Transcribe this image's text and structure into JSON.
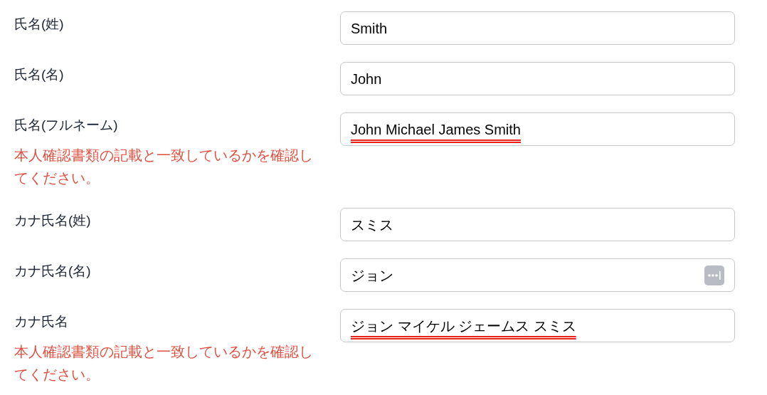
{
  "fields": [
    {
      "label": "氏名(姓)",
      "value": "Smith",
      "spellcheck_flag": false,
      "autofill_icon": false
    },
    {
      "label": "氏名(名)",
      "value": "John",
      "spellcheck_flag": false,
      "autofill_icon": false
    },
    {
      "label": "氏名(フルネーム)",
      "value": "John Michael James Smith",
      "spellcheck_flag": true,
      "autofill_icon": false,
      "warning": "本人確認書類の記載と一致しているかを確認してください。"
    },
    {
      "label": "カナ氏名(姓)",
      "value": "スミス",
      "spellcheck_flag": false,
      "autofill_icon": false
    },
    {
      "label": "カナ氏名(名)",
      "value": "ジョン",
      "spellcheck_flag": false,
      "autofill_icon": true
    },
    {
      "label": "カナ氏名",
      "value": "ジョン マイケル ジェームス スミス",
      "spellcheck_flag": true,
      "autofill_icon": false,
      "warning": "本人確認書類の記載と一致しているかを確認してください。"
    }
  ]
}
